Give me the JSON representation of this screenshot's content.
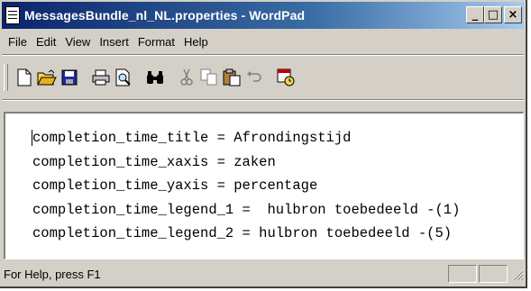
{
  "window": {
    "title": "MessagesBundle_nl_NL.properties - WordPad",
    "minimize_glyph": "_",
    "maximize_glyph": "□",
    "close_glyph": "×"
  },
  "menu": [
    "File",
    "Edit",
    "View",
    "Insert",
    "Format",
    "Help"
  ],
  "toolbar": {
    "buttons": [
      "new-icon",
      "open-icon",
      "save-icon",
      "print-icon",
      "print-preview-icon",
      "find-icon",
      "cut-icon",
      "copy-icon",
      "paste-icon",
      "undo-icon",
      "date-time-icon"
    ]
  },
  "document": {
    "lines": [
      "completion_time_title = Afrondingstijd",
      "completion_time_xaxis = zaken",
      "completion_time_yaxis = percentage",
      "completion_time_legend_1 =  hulbron toebedeeld -(1)",
      "completion_time_legend_2 = hulbron toebedeeld -(5)"
    ]
  },
  "status": {
    "text": "For Help, press F1"
  },
  "colors": {
    "titlebar_start": "#0a246a",
    "titlebar_end": "#a6caf0",
    "chrome": "#d4d0c8"
  }
}
